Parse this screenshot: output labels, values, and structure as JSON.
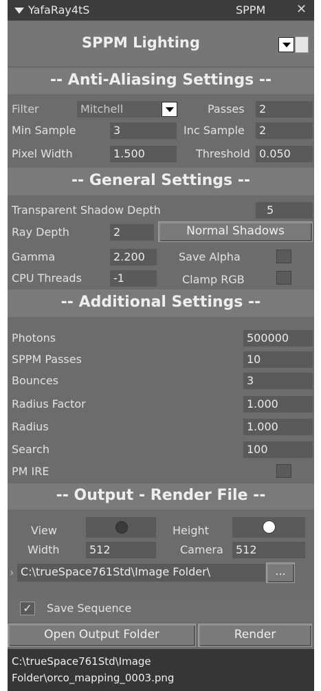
{
  "titlebar": {
    "title": "YafaRay4tS",
    "tab": "SPPM",
    "close": "✕"
  },
  "method": {
    "label": "SPPM Lighting"
  },
  "aa": {
    "header": "-- Anti-Aliasing Settings --",
    "filter_label": "Filter",
    "filter_value": "Mitchell",
    "passes_label": "Passes",
    "passes_value": "2",
    "min_sample_label": "Min Sample",
    "min_sample_value": "3",
    "inc_sample_label": "Inc Sample",
    "inc_sample_value": "2",
    "pixel_width_label": "Pixel Width",
    "pixel_width_value": "1.500",
    "threshold_label": "Threshold",
    "threshold_value": "0.050"
  },
  "general": {
    "header": "-- General Settings --",
    "tsd_label": "Transparent Shadow Depth",
    "tsd_value": "5",
    "ray_depth_label": "Ray Depth",
    "ray_depth_value": "2",
    "shadows_button": "Normal Shadows",
    "gamma_label": "Gamma",
    "gamma_value": "2.200",
    "save_alpha_label": "Save Alpha",
    "cpu_threads_label": "CPU Threads",
    "cpu_threads_value": "-1",
    "clamp_rgb_label": "Clamp RGB"
  },
  "additional": {
    "header": "-- Additional Settings --",
    "photons_label": "Photons",
    "photons_value": "500000",
    "sppm_passes_label": "SPPM Passes",
    "sppm_passes_value": "10",
    "bounces_label": "Bounces",
    "bounces_value": "3",
    "radius_factor_label": "Radius Factor",
    "radius_factor_value": "1.000",
    "radius_label": "Radius",
    "radius_value": "1.000",
    "search_label": "Search",
    "search_value": "100",
    "pm_ire_label": "PM IRE"
  },
  "output": {
    "header": "-- Output - Render File --",
    "view_label": "View",
    "height_label": "Height",
    "width_label": "Width",
    "width_value": "512",
    "camera_label": "Camera",
    "camera_value": "512",
    "path_value": "C:\\trueSpace761Std\\Image Folder\\",
    "browse_button": "...",
    "save_sequence_label": "Save Sequence",
    "save_sequence_checked": "✓",
    "open_folder_button": "Open Output Folder",
    "render_button": "Render",
    "status_line1": "C:\\trueSpace761Std\\Image",
    "status_line2": "Folder\\orco_mapping_0003.png"
  }
}
